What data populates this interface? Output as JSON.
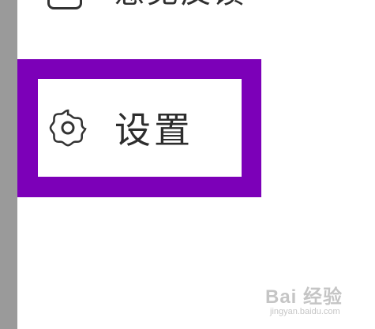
{
  "top_item": {
    "label": "意见反馈",
    "icon": "feedback-icon"
  },
  "settings_item": {
    "label": "设置",
    "icon": "gear-icon"
  },
  "colors": {
    "highlight": "#7c00b8",
    "left_strip": "#9a9a9a"
  },
  "watermark": {
    "logo": "Bai 经验",
    "url": "jingyan.baidu.com"
  }
}
